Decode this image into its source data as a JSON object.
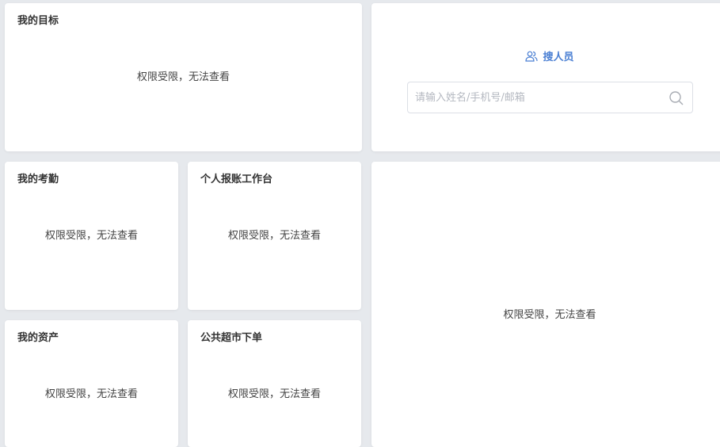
{
  "no_permission_text": "权限受限，无法查看",
  "cards": {
    "my_goals": {
      "title": "我的目标"
    },
    "search_people": {
      "title": "搜人员",
      "placeholder": "请输入姓名/手机号/邮箱",
      "icon": "user-group-icon",
      "accent": "#4a7fd3"
    },
    "my_attendance": {
      "title": "我的考勤"
    },
    "reimbursement": {
      "title": "个人报账工作台"
    },
    "my_assets": {
      "title": "我的资产"
    },
    "public_market": {
      "title": "公共超市下单"
    }
  }
}
